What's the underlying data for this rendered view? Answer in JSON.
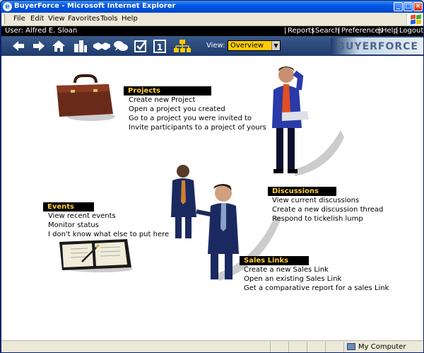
{
  "window": {
    "title": "BuyerForce - Microsoft Internet Explorer"
  },
  "menu": [
    "File",
    "Edit",
    "View",
    "Favorites",
    "Tools",
    "Help"
  ],
  "header": {
    "user": "User: Alfred E. Sloan",
    "links": [
      "Reports",
      "Search",
      "Preferences",
      "Help",
      "Logout"
    ]
  },
  "toolbar": {
    "icons": [
      "back-arrow-icon",
      "forward-arrow-icon",
      "home-icon",
      "buildings-icon",
      "handshake-icon",
      "chat-icon",
      "checkbox-icon",
      "calendar-icon",
      "org-chart-icon"
    ],
    "view_label": "View:",
    "view_value": "Overview",
    "brand": "BUYERFORCE"
  },
  "sections": {
    "projects": {
      "title": "Projects",
      "links": [
        "Create new Project",
        "Open a project you created",
        "Go to a project you were invited to",
        "Invite participants to a project of yours"
      ]
    },
    "discussions": {
      "title": "Discussions",
      "links": [
        "View current discussions",
        "Create a new discussion thread",
        "Respond to tickelish lump"
      ]
    },
    "events": {
      "title": "Events",
      "links": [
        "View recent events",
        "Monitor status",
        "I don't know what else to put here"
      ]
    },
    "sales_links": {
      "title": "Sales Links",
      "links": [
        "Create a new Sales Link",
        "Open an existing Sales Link",
        "Get a comparative report for a sales Link"
      ]
    }
  },
  "status": {
    "zone": "My Computer"
  },
  "colors": {
    "section_title_bg": "#000000",
    "section_title_fg": "#ffcc33",
    "view_select_bg": "#ffcc00",
    "toolbar_bg": "#1e3a6c"
  }
}
